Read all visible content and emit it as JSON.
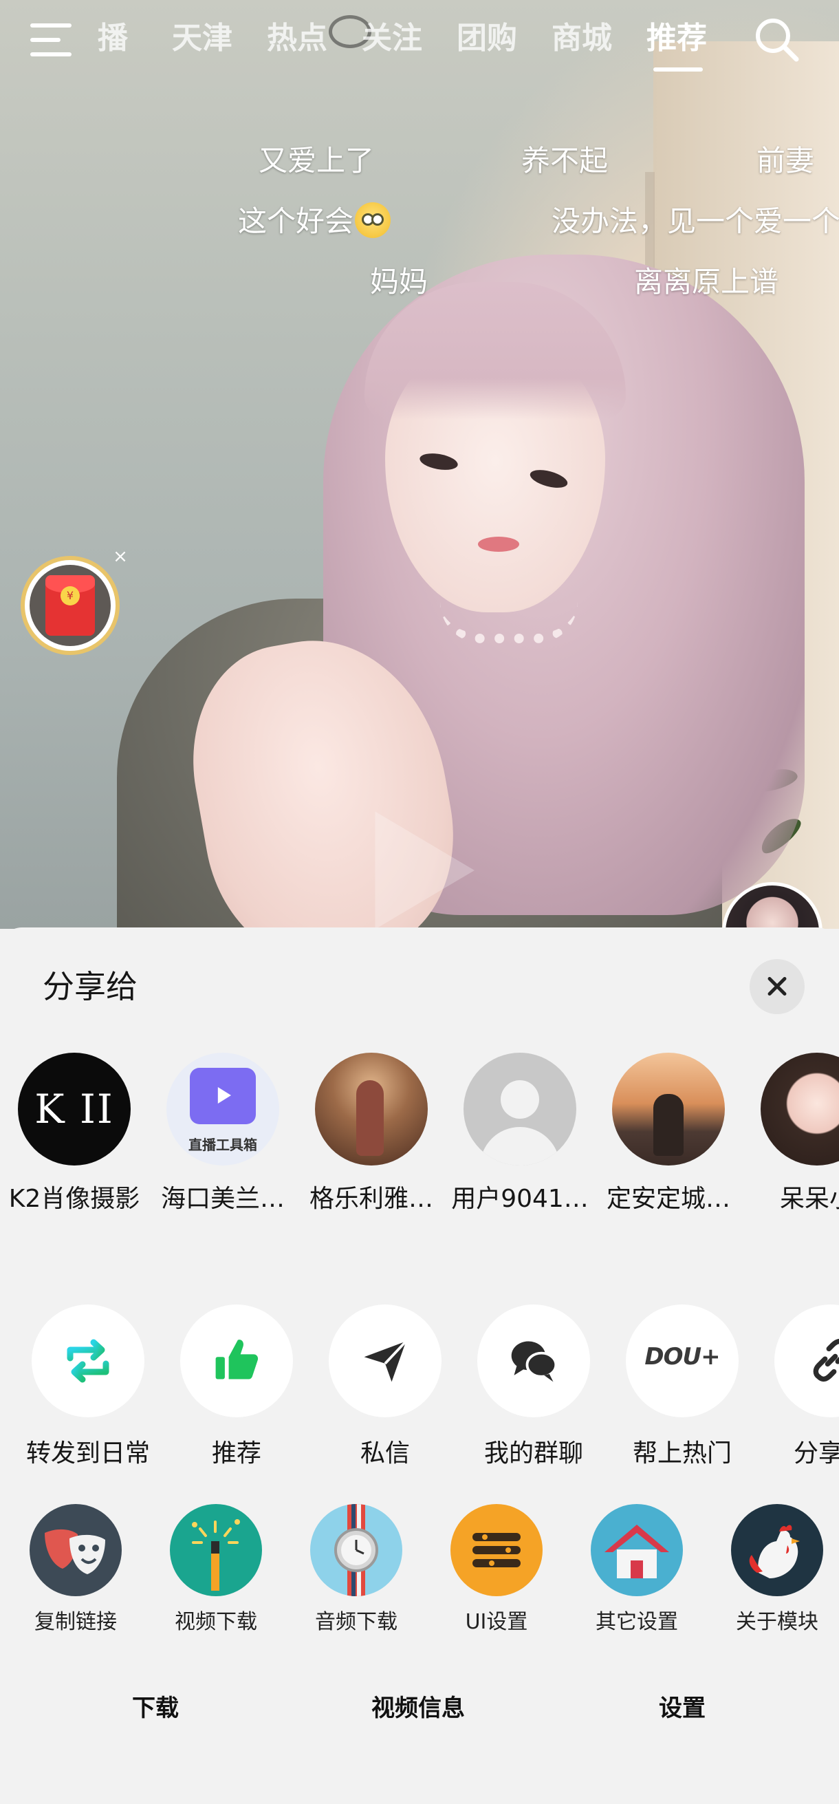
{
  "nav": {
    "tabs": [
      "播",
      "天津",
      "热点",
      "关注",
      "团购",
      "商城",
      "推荐"
    ],
    "active_tab": "推荐",
    "menu_icon": "menu-icon",
    "search_icon": "search-icon"
  },
  "danmaku": [
    "又爱上了",
    "养不起",
    "前妻",
    "这个好会",
    "没办法，见一个爱一个",
    "妈妈",
    "离离原上谱"
  ],
  "red_packet": {
    "icon": "red-envelope-icon",
    "coin": "¥",
    "close": "×"
  },
  "share_sheet": {
    "title": "分享给",
    "contacts": [
      {
        "name": "K2肖像摄影",
        "avatar_text": "K II"
      },
      {
        "name": "海口美兰…",
        "avatar_text": "直播工具箱"
      },
      {
        "name": "格乐利雅…"
      },
      {
        "name": "用户9041…"
      },
      {
        "name": "定安定城…"
      },
      {
        "name": "呆呆小"
      }
    ],
    "actions": [
      {
        "label": "转发到日常",
        "icon": "repost-icon"
      },
      {
        "label": "推荐",
        "icon": "thumbs-up-icon"
      },
      {
        "label": "私信",
        "icon": "send-icon"
      },
      {
        "label": "我的群聊",
        "icon": "group-chat-icon"
      },
      {
        "label": "帮上热门",
        "icon": "dou-plus-icon",
        "icon_text": "DOU+"
      },
      {
        "label": "分享链",
        "icon": "link-icon"
      }
    ],
    "modules": [
      {
        "label": "复制链接",
        "icon": "theater-mask-icon",
        "color": "#3d4a56"
      },
      {
        "label": "视频下载",
        "icon": "magic-wand-icon",
        "color": "#1aa58f"
      },
      {
        "label": "音频下载",
        "icon": "watch-icon",
        "color": "#8ed2ea"
      },
      {
        "label": "UI设置",
        "icon": "list-menu-icon",
        "color": "#f5a326"
      },
      {
        "label": "其它设置",
        "icon": "house-icon",
        "color": "#4ab0d0"
      },
      {
        "label": "关于模块",
        "icon": "rooster-icon",
        "color": "#1f3442"
      }
    ],
    "bottom_tabs": [
      "下载",
      "视频信息",
      "设置"
    ]
  }
}
